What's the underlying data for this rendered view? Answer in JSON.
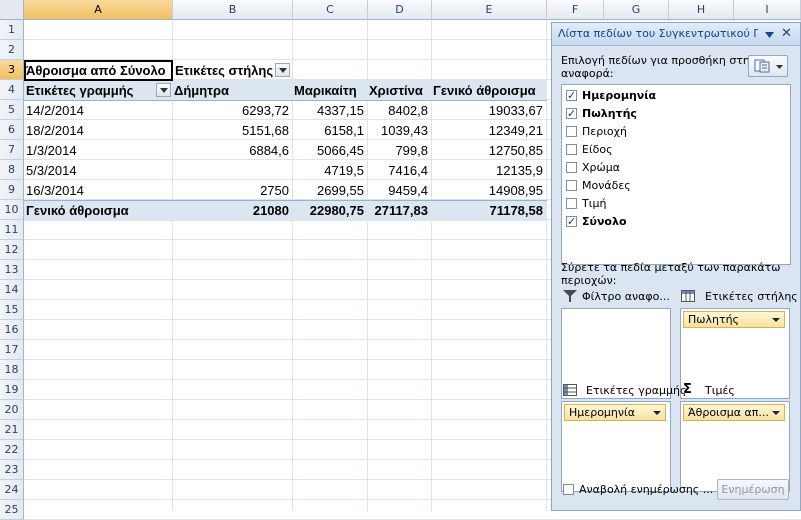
{
  "columns": [
    "A",
    "B",
    "C",
    "D",
    "E",
    "F",
    "G",
    "H",
    "I"
  ],
  "rows": [
    "1",
    "2",
    "3",
    "4",
    "5",
    "6",
    "7",
    "8",
    "9",
    "10",
    "11",
    "12",
    "13",
    "14",
    "15",
    "16",
    "17",
    "18",
    "19",
    "20",
    "21",
    "22",
    "23",
    "24",
    "25"
  ],
  "pivot": {
    "header_sum": "Άθροισμα από Σύνολο",
    "col_labels": "Ετικέτες στήλης",
    "row_labels": "Ετικέτες γραμμής",
    "col_names": [
      "Δήμητρα",
      "Μαρικαίτη",
      "Χριστίνα",
      "Γενικό άθροισμα"
    ],
    "data_rows": [
      {
        "label": "14/2/2014",
        "vals": [
          "6293,72",
          "4337,15",
          "8402,8",
          "19033,67"
        ]
      },
      {
        "label": "18/2/2014",
        "vals": [
          "5151,68",
          "6158,1",
          "1039,43",
          "12349,21"
        ]
      },
      {
        "label": "1/3/2014",
        "vals": [
          "6884,6",
          "5066,45",
          "799,8",
          "12750,85"
        ]
      },
      {
        "label": "5/3/2014",
        "vals": [
          "",
          "4719,5",
          "7416,4",
          "12135,9"
        ]
      },
      {
        "label": "16/3/2014",
        "vals": [
          "2750",
          "2699,55",
          "9459,4",
          "14908,95"
        ]
      }
    ],
    "total_label": "Γενικό άθροισμα",
    "total_vals": [
      "21080",
      "22980,75",
      "27117,83",
      "71178,58"
    ]
  },
  "pane": {
    "title": "Λίστα πεδίων του Συγκεντρωτικού Π",
    "choose_text_1": "Επιλογή πεδίων για προσθήκη στην",
    "choose_text_2": "αναφορά:",
    "fields": [
      {
        "label": "Ημερομηνία",
        "checked": true
      },
      {
        "label": "Πωλητής",
        "checked": true
      },
      {
        "label": "Περιοχή",
        "checked": false
      },
      {
        "label": "Είδος",
        "checked": false
      },
      {
        "label": "Χρώμα",
        "checked": false
      },
      {
        "label": "Μονάδες",
        "checked": false
      },
      {
        "label": "Τιμή",
        "checked": false
      },
      {
        "label": "Σύνολο",
        "checked": true
      }
    ],
    "drag_text_1": "Σύρετε τα πεδία μεταξύ των παρακάτω",
    "drag_text_2": "περιοχών:",
    "area_filter": "Φίλτρο αναφο...",
    "area_columns": "Ετικέτες στήλης",
    "area_rows": "Ετικέτες γραμμής",
    "area_values": "Τιμές",
    "pill_columns": "Πωλητής",
    "pill_rows": "Ημερομηνία",
    "pill_values": "Άθροισμα απ...",
    "defer_label": "Αναβολή ενημέρωσης ...",
    "update_button": "Ενημέρωση"
  }
}
